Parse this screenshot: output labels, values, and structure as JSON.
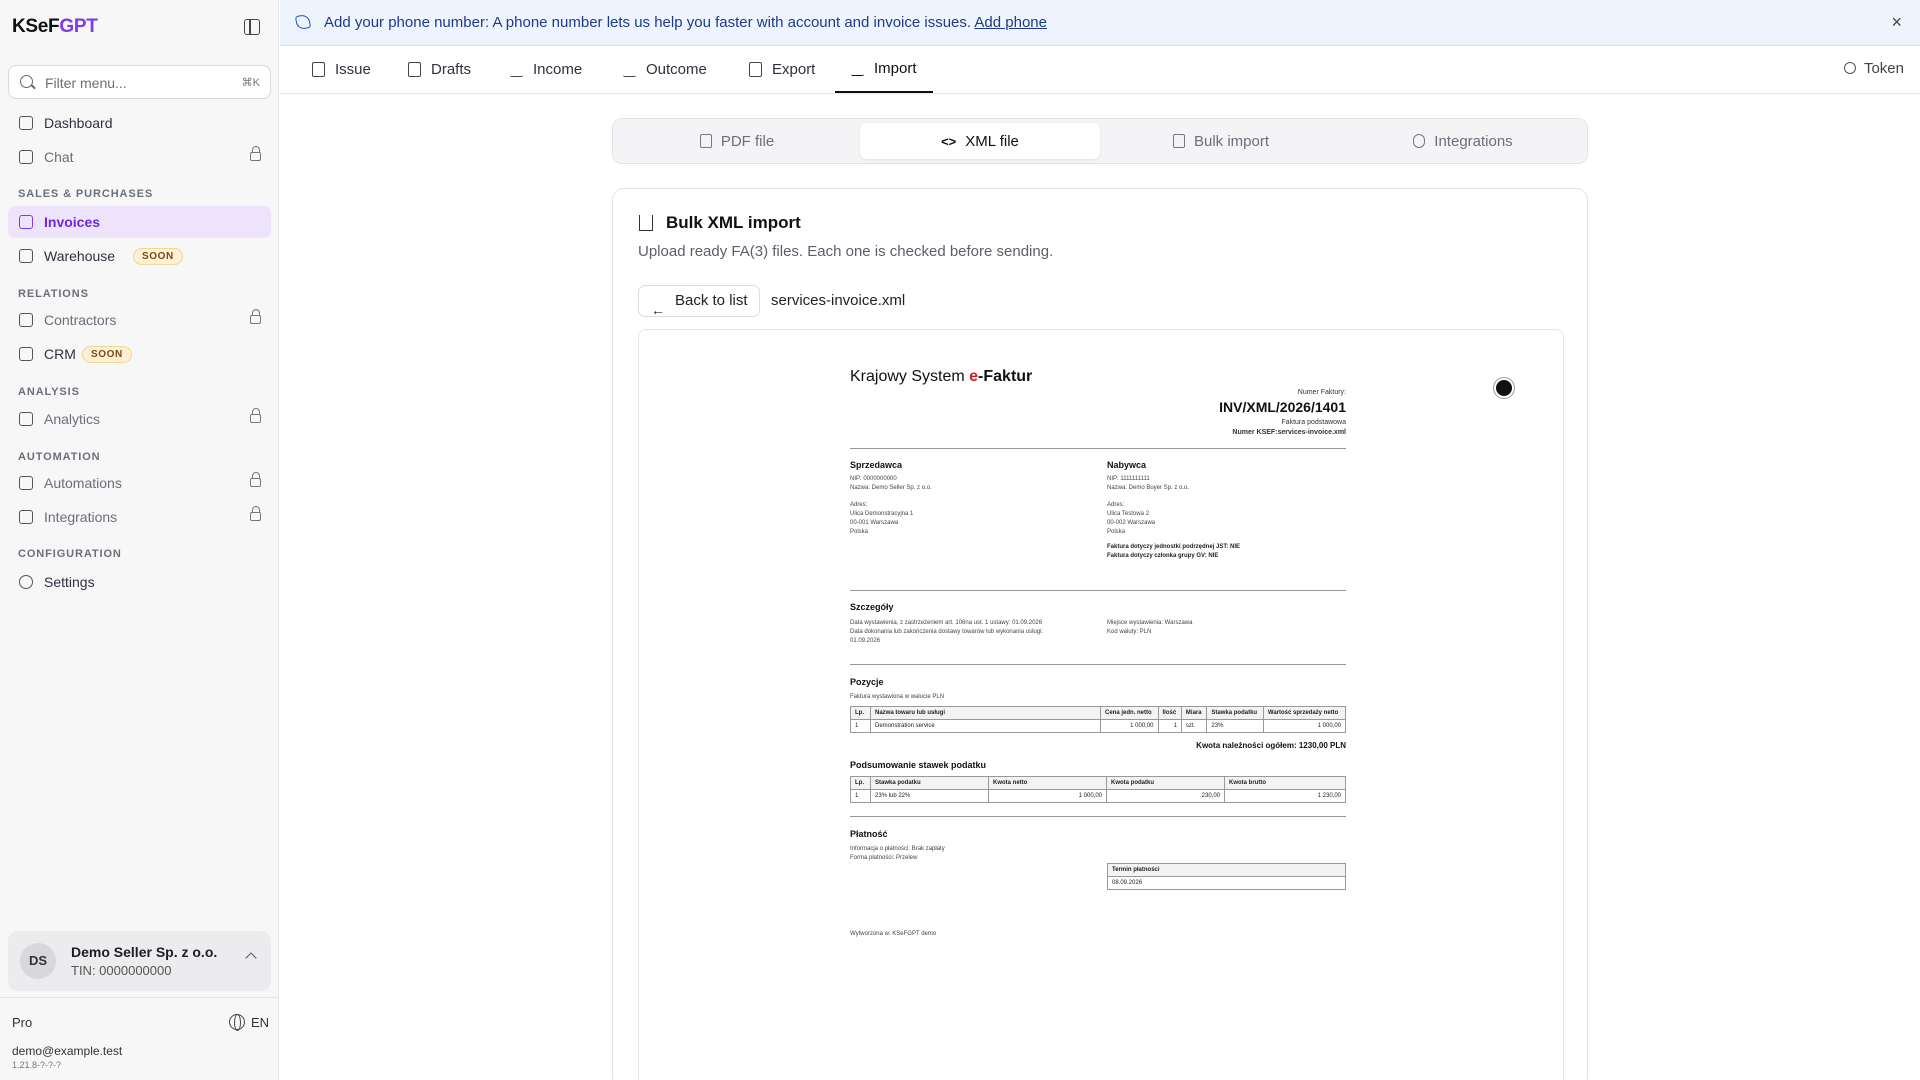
{
  "app": {
    "logo_a": "KSeF",
    "logo_b": "GPT"
  },
  "sidebar": {
    "filter_placeholder": "Filter menu...",
    "filter_shortcut": "⌘K",
    "dashboard": "Dashboard",
    "chat": "Chat",
    "section_sales": "SALES & PURCHASES",
    "invoices": "Invoices",
    "warehouse": "Warehouse",
    "soon": "SOON",
    "section_relations": "RELATIONS",
    "contractors": "Contractors",
    "crm": "CRM",
    "section_analysis": "ANALYSIS",
    "analytics": "Analytics",
    "section_automation": "AUTOMATION",
    "automations": "Automations",
    "integrations": "Integrations",
    "section_configuration": "CONFIGURATION",
    "settings": "Settings",
    "account": {
      "initials": "DS",
      "name": "Demo Seller Sp. z o.o.",
      "tin": "TIN: 0000000000"
    },
    "plan": "Pro",
    "lang": "EN",
    "email": "demo@example.test",
    "version": "1.21.8-?-?-?"
  },
  "banner": {
    "text": "Add your phone number: A phone number lets us help you faster with account and invoice issues.",
    "link": "Add phone",
    "close": "×"
  },
  "tabs": {
    "issue": "Issue",
    "drafts": "Drafts",
    "income": "Income",
    "outcome": "Outcome",
    "export": "Export",
    "import": "Import",
    "token": "Token"
  },
  "subtabs": {
    "pdf": "PDF file",
    "xml": "XML file",
    "bulk": "Bulk import",
    "integrations": "Integrations"
  },
  "card": {
    "title": "Bulk XML import",
    "subtitle": "Upload ready FA(3) files. Each one is checked before sending.",
    "back": "Back to list",
    "file": "services-invoice.xml"
  },
  "invoice": {
    "brand_a": "Krajowy System ",
    "brand_e": "e",
    "brand_b": "-Faktur",
    "num_label": "Numer Faktury:",
    "number": "INV/XML/2026/1401",
    "kind": "Faktura podstawowa",
    "ksef": "Numer KSEF:services-invoice.xml",
    "seller_h": "Sprzedawca",
    "seller_nip": "NIP: 0000000000",
    "seller_name": "Nazwa: Demo Seller Sp. z o.o.",
    "seller_addr_l": "Adres:",
    "seller_addr1": "Ulica Demonstracyjna 1",
    "seller_addr2": "00-001 Warszawa",
    "seller_addr3": "Polska",
    "buyer_h": "Nabywca",
    "buyer_nip": "NIP: 1111111111",
    "buyer_name": "Nazwa: Demo Buyer Sp. z o.o.",
    "buyer_addr_l": "Adres:",
    "buyer_addr1": "Ulica Testowa 2",
    "buyer_addr2": "00-002 Warszawa",
    "buyer_addr3": "Polska",
    "buyer_jst": "Faktura dotyczy jednostki podrzędnej JST: NIE",
    "buyer_gv": "Faktura dotyczy członka grupy GV: NIE",
    "details_h": "Szczegóły",
    "issue_date": "Data wystawienia, z zastrzeżeniem art. 106na ust. 1 ustawy: 01.09.2026",
    "delivery_date": "Data dokonania lub zakończenia dostawy towarów lub wykonania usługi:",
    "delivery_date2": "01.09.2026",
    "place": "Miejsce wystawienia: Warszawa",
    "currency": "Kod waluty: PLN",
    "positions_h": "Pozycje",
    "positions_note": "Faktura wystawiona w walucie PLN",
    "pos_head": [
      "Lp.",
      "Nazwa towaru lub usługi",
      "Cena jedn. netto",
      "Ilość",
      "Miara",
      "Stawka podatku",
      "Wartość sprzedaży netto"
    ],
    "pos_row": [
      "1",
      "Demonstration service",
      "1 000,00",
      "1",
      "szt.",
      "23%",
      "1 000,00"
    ],
    "total": "Kwota należności ogółem: 1230,00 PLN",
    "summary_h": "Podsumowanie stawek podatku",
    "sum_head": [
      "Lp.",
      "Stawka podatku",
      "Kwota netto",
      "Kwota podatku",
      "Kwota brutto"
    ],
    "sum_row": [
      "1",
      "23% lub 22%",
      "1 000,00",
      "230,00",
      "1 230,00"
    ],
    "payment_h": "Płatność",
    "pay_info": "Informacja o płatności: Brak zapłaty",
    "pay_form": "Forma płatności: Przelew",
    "due_label": "Termin płatności",
    "due_date": "08.09.2026",
    "generated": "Wytworzona w: KSeFGPT demo"
  }
}
